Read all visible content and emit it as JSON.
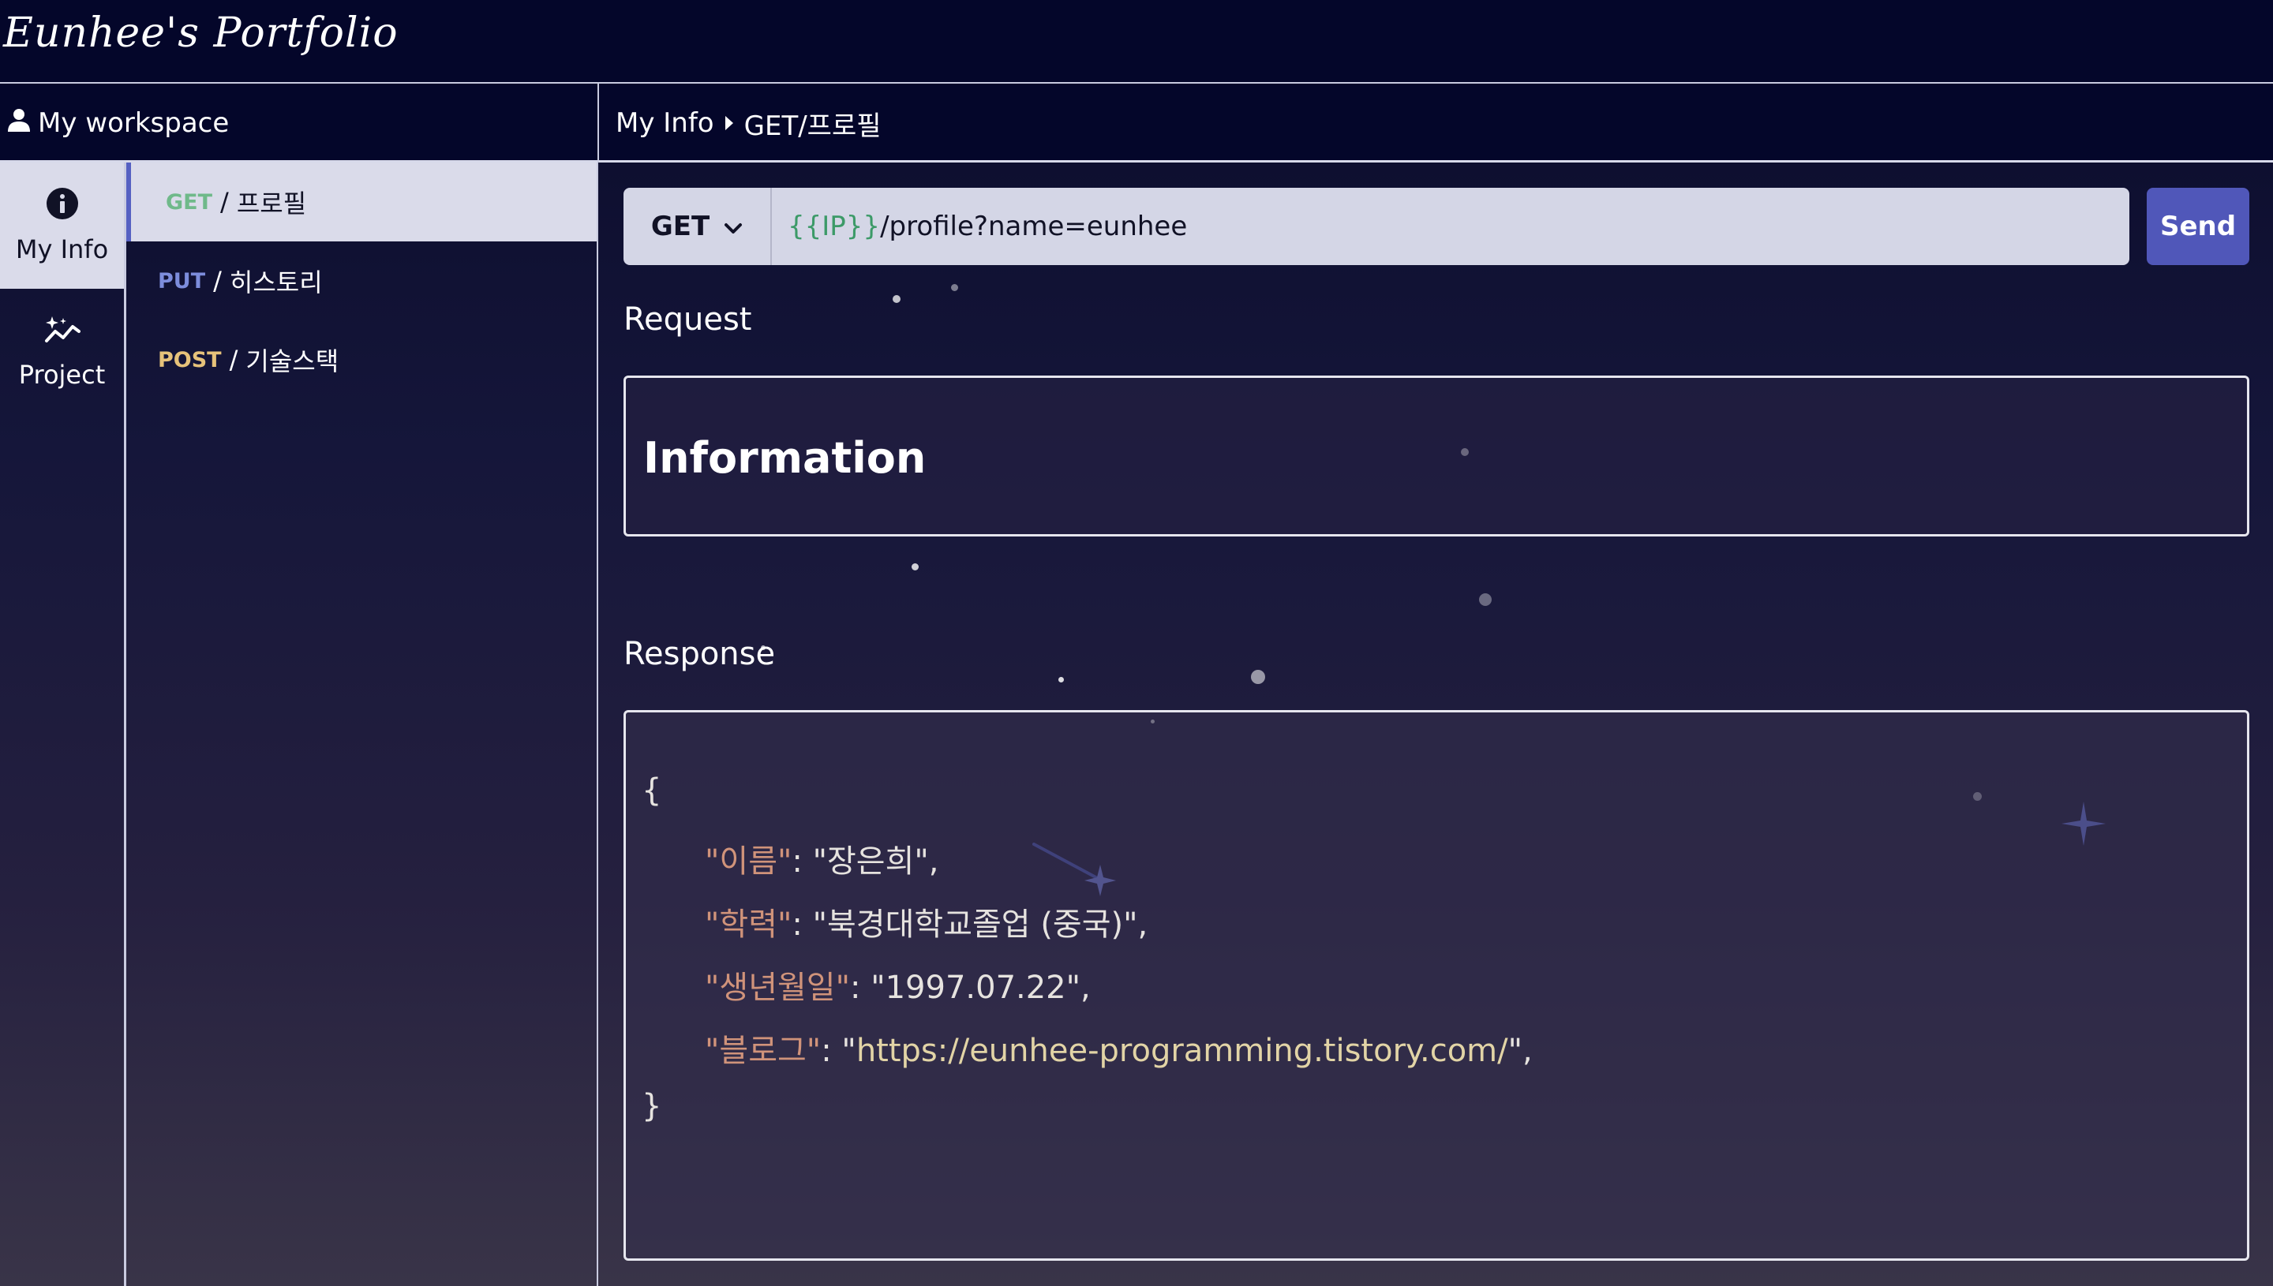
{
  "app": {
    "logo": "Eunhee's Portfolio"
  },
  "workspace": {
    "title": "My workspace",
    "user_icon": "user-icon"
  },
  "breadcrumb": {
    "parent": "My Info",
    "current": "GET/프로필",
    "separator_icon": "caret-right-icon"
  },
  "rail": {
    "items": [
      {
        "label": "My Info",
        "icon": "info-circle-icon",
        "active": true
      },
      {
        "label": "Project",
        "icon": "sparkle-chart-icon",
        "active": false
      }
    ]
  },
  "endpoints": {
    "items": [
      {
        "method": "GET",
        "separator": "/",
        "name": "프로필",
        "method_color": "#6fb98a",
        "active": true
      },
      {
        "method": "PUT",
        "separator": "/",
        "name": "히스토리",
        "method_color": "#7d8ddc",
        "active": false
      },
      {
        "method": "POST",
        "separator": "/",
        "name": "기술스택",
        "method_color": "#e6c27a",
        "active": false
      }
    ]
  },
  "request_bar": {
    "method": "GET",
    "url_variable": "{{IP}}",
    "url_path": "/profile?name=eunhee",
    "send_label": "Send"
  },
  "request": {
    "label": "Request",
    "title": "Information"
  },
  "response": {
    "label": "Response",
    "open_brace": "{",
    "close_brace": "}",
    "fields": [
      {
        "key": "\"이름\"",
        "colon": ": ",
        "value": "\"장은희\",",
        "is_link": false
      },
      {
        "key": "\"학력\"",
        "colon": ": ",
        "value": "\"북경대학교졸업 (중국)\",",
        "is_link": false
      },
      {
        "key": "\"생년월일\"",
        "colon": ": ",
        "value": "\"1997.07.22\",",
        "is_link": false
      },
      {
        "key": "\"블로그\"",
        "colon": ": ",
        "value_prefix": "\"",
        "link": "https://eunhee-programming.tistory.com/",
        "value_suffix": "\",",
        "is_link": true
      }
    ]
  },
  "colors": {
    "top_bar": "#04062a",
    "accent": "#5057b9",
    "selected_bg": "#dadbea",
    "url_variable": "#3c9a68",
    "json_key": "#d0937a",
    "json_link": "#e2d4a6"
  }
}
